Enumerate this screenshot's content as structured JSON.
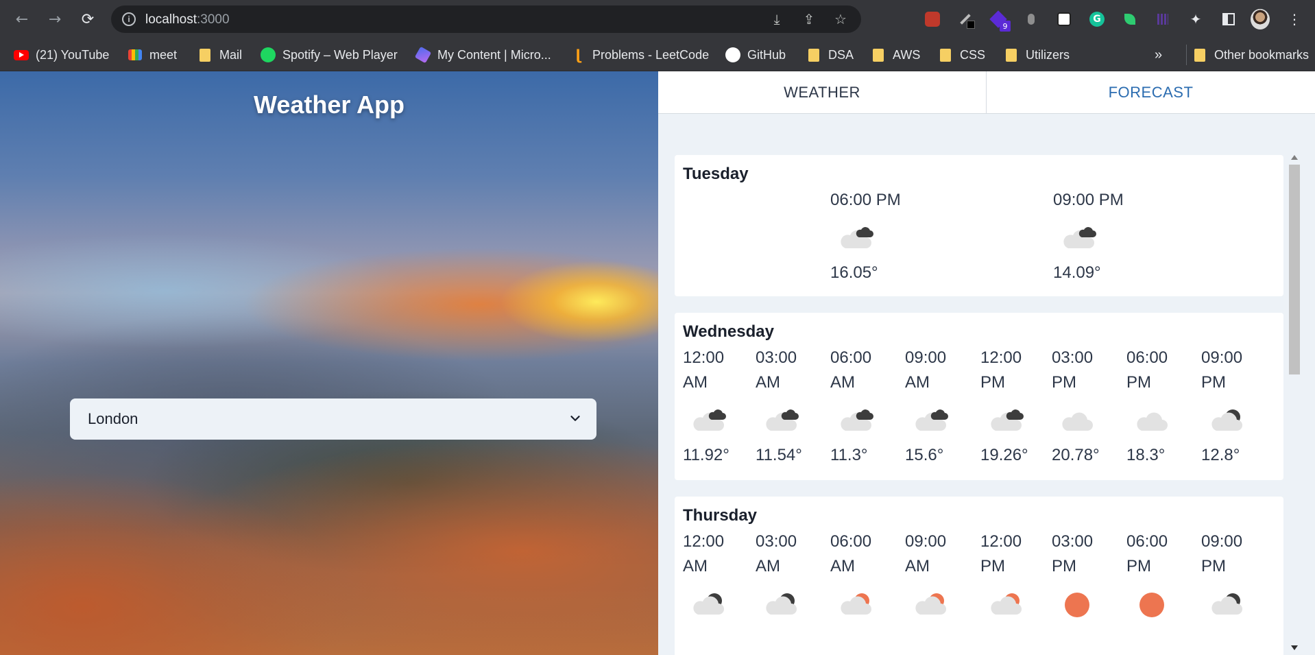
{
  "browser": {
    "url_host": "localhost",
    "url_port": ":3000",
    "ext_badge": "9"
  },
  "bookmarks": [
    {
      "label": "(21) YouTube",
      "icon": "youtube-icon"
    },
    {
      "label": "meet",
      "icon": "meet-icon"
    },
    {
      "label": "Mail",
      "icon": "folder-icon"
    },
    {
      "label": "Spotify – Web Player",
      "icon": "spotify-icon"
    },
    {
      "label": "My Content | Micro...",
      "icon": "microsoft-icon"
    },
    {
      "label": "Problems - LeetCode",
      "icon": "leetcode-icon"
    },
    {
      "label": "GitHub",
      "icon": "github-icon"
    },
    {
      "label": "DSA",
      "icon": "folder-icon"
    },
    {
      "label": "AWS",
      "icon": "folder-icon"
    },
    {
      "label": "CSS",
      "icon": "folder-icon"
    },
    {
      "label": "Utilizers",
      "icon": "folder-icon"
    }
  ],
  "bookmarks_overflow": "»",
  "other_bookmarks": "Other bookmarks",
  "app": {
    "title": "Weather App",
    "city": "London"
  },
  "tabs": {
    "weather": "WEATHER",
    "forecast": "FORECAST",
    "active": "forecast"
  },
  "colors": {
    "accent": "#2b6cb0",
    "sun": "#ed7550",
    "cloud": "#e2e2e2",
    "dark_cloud": "#3d3d3d"
  },
  "forecast": [
    {
      "day": "Tuesday",
      "slots": [
        {
          "time": "06:00 PM",
          "icon": "scattered-clouds-icon",
          "temp": "16.05°"
        },
        {
          "time": "09:00 PM",
          "icon": "scattered-clouds-icon",
          "temp": "14.09°"
        }
      ]
    },
    {
      "day": "Wednesday",
      "slots": [
        {
          "time": "12:00 AM",
          "icon": "scattered-clouds-icon",
          "temp": "11.92°"
        },
        {
          "time": "03:00 AM",
          "icon": "scattered-clouds-icon",
          "temp": "11.54°"
        },
        {
          "time": "06:00 AM",
          "icon": "scattered-clouds-icon",
          "temp": "11.3°"
        },
        {
          "time": "09:00 AM",
          "icon": "scattered-clouds-icon",
          "temp": "15.6°"
        },
        {
          "time": "12:00 PM",
          "icon": "scattered-clouds-icon",
          "temp": "19.26°"
        },
        {
          "time": "03:00 PM",
          "icon": "cloud-icon",
          "temp": "20.78°"
        },
        {
          "time": "06:00 PM",
          "icon": "cloud-icon",
          "temp": "18.3°"
        },
        {
          "time": "09:00 PM",
          "icon": "night-cloud-icon",
          "temp": "12.8°"
        }
      ]
    },
    {
      "day": "Thursday",
      "slots": [
        {
          "time": "12:00 AM",
          "icon": "night-cloud-icon",
          "temp": ""
        },
        {
          "time": "03:00 AM",
          "icon": "night-cloud-icon",
          "temp": ""
        },
        {
          "time": "06:00 AM",
          "icon": "sun-cloud-icon",
          "temp": ""
        },
        {
          "time": "09:00 AM",
          "icon": "sun-cloud-icon",
          "temp": ""
        },
        {
          "time": "12:00 PM",
          "icon": "sun-cloud-icon",
          "temp": ""
        },
        {
          "time": "03:00 PM",
          "icon": "sun-icon",
          "temp": ""
        },
        {
          "time": "06:00 PM",
          "icon": "sun-icon",
          "temp": ""
        },
        {
          "time": "09:00 PM",
          "icon": "night-cloud-icon",
          "temp": ""
        }
      ]
    }
  ]
}
